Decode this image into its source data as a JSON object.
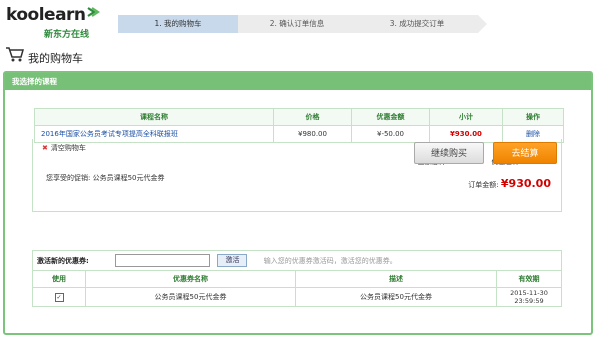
{
  "brand": {
    "name": "koolearn",
    "sub": "新东方在线"
  },
  "steps": [
    "1. 我的购物车",
    "2. 确认订单信息",
    "3. 成功提交订单"
  ],
  "page_title": "我的购物车",
  "panel_title": "我选择的课程",
  "cart": {
    "headers": [
      "课程名称",
      "价格",
      "优惠金额",
      "小计",
      "操作"
    ],
    "rows": [
      {
        "name": "2016年国家公务员考试专项提高全科联报班",
        "price": "¥980.00",
        "discount": "¥-50.00",
        "subtotal": "¥930.00",
        "action": "删除"
      }
    ]
  },
  "promo_text": "您享受的促销: 公务员课程50元代金券",
  "totals": {
    "amount_label": "金额总计: ¥980.00",
    "discount_label": "优惠总计: ¥-50.00",
    "order_label": "订单金额:",
    "order_value": "¥930.00"
  },
  "clear_cart": "清空购物车",
  "buttons": {
    "continue": "继续购买",
    "checkout": "去结算"
  },
  "coupon": {
    "activate_label": "激活新的优惠券:",
    "activate_button": "激活",
    "hint": "输入您的优惠券激活码，激活您的优惠券。",
    "headers": [
      "使用",
      "优惠券名称",
      "描述",
      "有效期"
    ],
    "rows": [
      {
        "checked": "✓",
        "name": "公务员课程50元代金券",
        "desc": "公务员课程50元代金券",
        "expiry": "2015-11-30 23:59:59"
      }
    ]
  },
  "colors": {
    "accent_green": "#77c077",
    "price_red": "#d40000",
    "checkout_orange": "#f08300"
  }
}
